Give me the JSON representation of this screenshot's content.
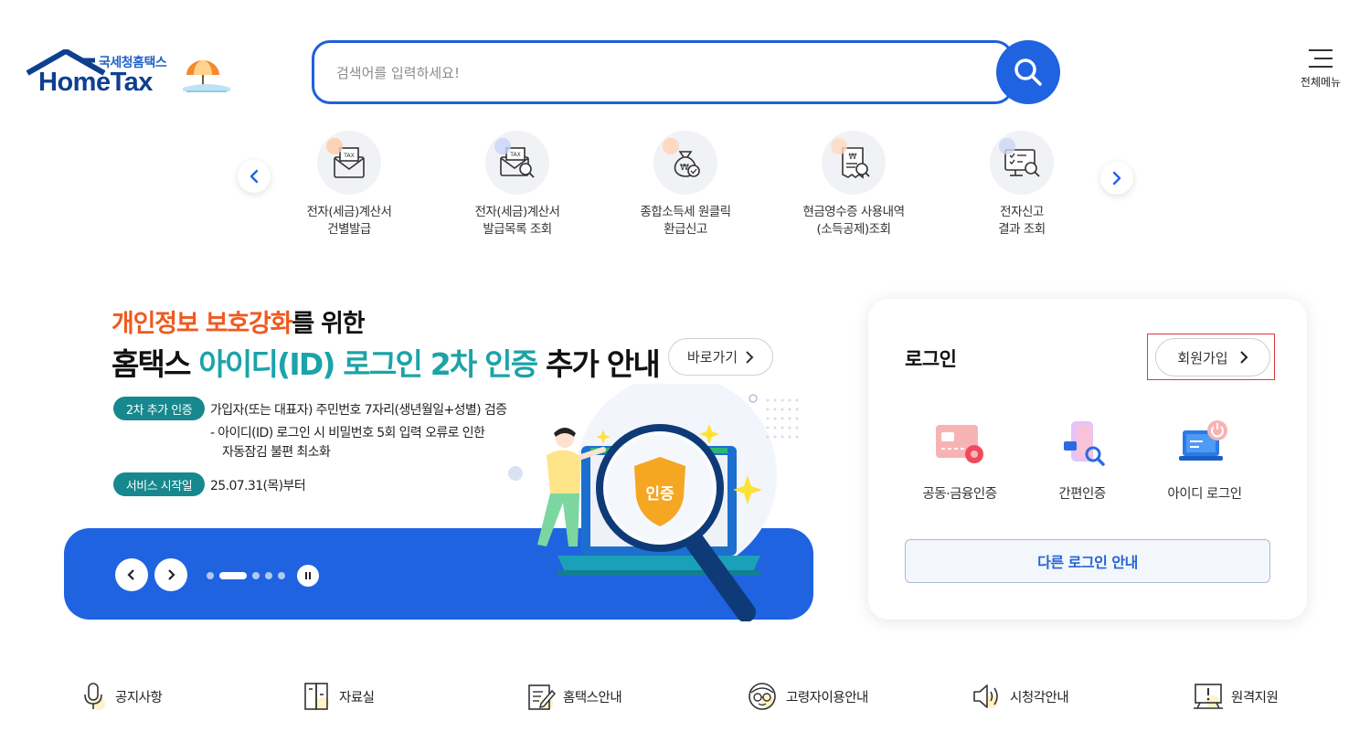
{
  "header": {
    "logo_sub": "국세청홈택스",
    "logo_main": "HomeTax",
    "search_placeholder": "검색어를 입력하세요!",
    "all_menu_label": "전체메뉴"
  },
  "quick_services": [
    {
      "line1": "전자(세금)계산서",
      "line2": "건별발급",
      "icon": "tax-envelope-icon"
    },
    {
      "line1": "전자(세금)계산서",
      "line2": "발급목록 조회",
      "icon": "tax-search-icon"
    },
    {
      "line1": "종합소득세 원클릭",
      "line2": "환급신고",
      "icon": "money-bag-icon"
    },
    {
      "line1": "현금영수증 사용내역",
      "line2": "(소득공제)조회",
      "icon": "receipt-search-icon"
    },
    {
      "line1": "전자신고",
      "line2": "결과 조회",
      "icon": "monitor-search-icon"
    }
  ],
  "banner": {
    "line1_highlight": "개인정보 보호강화",
    "line1_rest": "를 위한",
    "line2_part1": "홈택스 ",
    "line2_highlight": "아이디(ID) 로그인 2차 인증",
    "line2_part2": " 추가 안내",
    "goto_label": "바로가기",
    "tag1": "2차 추가 인증",
    "tag1_text": "가입자(또는 대표자) 주민번호 7자리(생년월일+성별) 검증",
    "tag1_sub1": "- 아이디(ID) 로그인 시 비밀번호 5회 입력 오류로 인한",
    "tag1_sub2": "자동잠김 불편 최소화",
    "tag2": "서비스 시작일",
    "tag2_text": "25.07.31(목)부터",
    "shield_text": "인증",
    "pager_count": 5,
    "pager_active": 1
  },
  "login": {
    "title": "로그인",
    "join_label": "회원가입",
    "options": [
      {
        "label": "공동·금융인증",
        "icon": "certificate-card-icon"
      },
      {
        "label": "간편인증",
        "icon": "simple-auth-phone-icon"
      },
      {
        "label": "아이디 로그인",
        "icon": "laptop-power-icon"
      }
    ],
    "other_label": "다른 로그인 안내"
  },
  "bottom_links": [
    {
      "label": "공지사항",
      "icon": "microphone-icon"
    },
    {
      "label": "자료실",
      "icon": "file-cabinet-icon"
    },
    {
      "label": "홈택스안내",
      "icon": "document-pen-icon"
    },
    {
      "label": "고령자이용안내",
      "icon": "elderly-glasses-icon"
    },
    {
      "label": "시청각안내",
      "icon": "speaker-icon"
    },
    {
      "label": "원격지원",
      "icon": "remote-monitor-icon"
    }
  ],
  "colors": {
    "primary_blue": "#1f63e0",
    "teal": "#1ba3a8",
    "orange": "#ef5a1f",
    "tag_teal": "#17888d",
    "join_highlight": "#e0393e"
  }
}
